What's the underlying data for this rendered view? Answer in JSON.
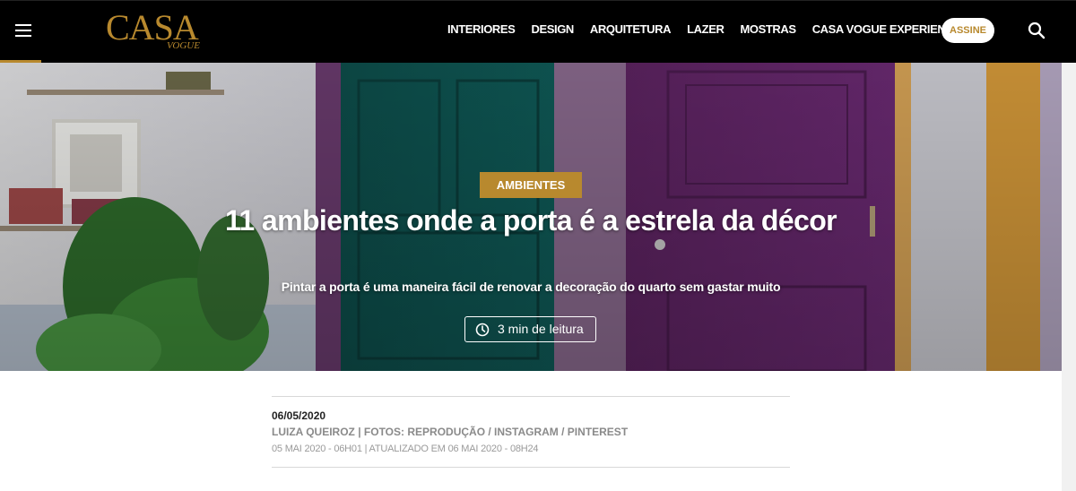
{
  "header": {
    "logo_text": "CASA",
    "logo_sub": "VOGUE",
    "nav": [
      "INTERIORES",
      "DESIGN",
      "ARQUITETURA",
      "LAZER",
      "MOSTRAS",
      "CASA VOGUE EXPERIENCE"
    ],
    "subscribe_label": "ASSINE",
    "icons": {
      "menu": "hamburger-icon",
      "search": "search-icon"
    }
  },
  "hero": {
    "tag": "AMBIENTES",
    "title": "11 ambientes onde a porta é a estrela da décor",
    "subtitle": "Pintar a porta é uma maneira fácil de renovar a decoração do quarto sem gastar muito",
    "read_time": "3 min de leitura",
    "read_icon": "clock-icon"
  },
  "meta": {
    "date": "06/05/2020",
    "author": "LUIZA QUEIROZ | FOTOS: REPRODUÇÃO / INSTAGRAM / PINTEREST",
    "published": "05 MAI 2020 - 06H01 | ATUALIZADO EM 06 MAI 2020 - 08H24"
  },
  "colors": {
    "accent": "#b8892e",
    "header_bg": "#000000"
  }
}
